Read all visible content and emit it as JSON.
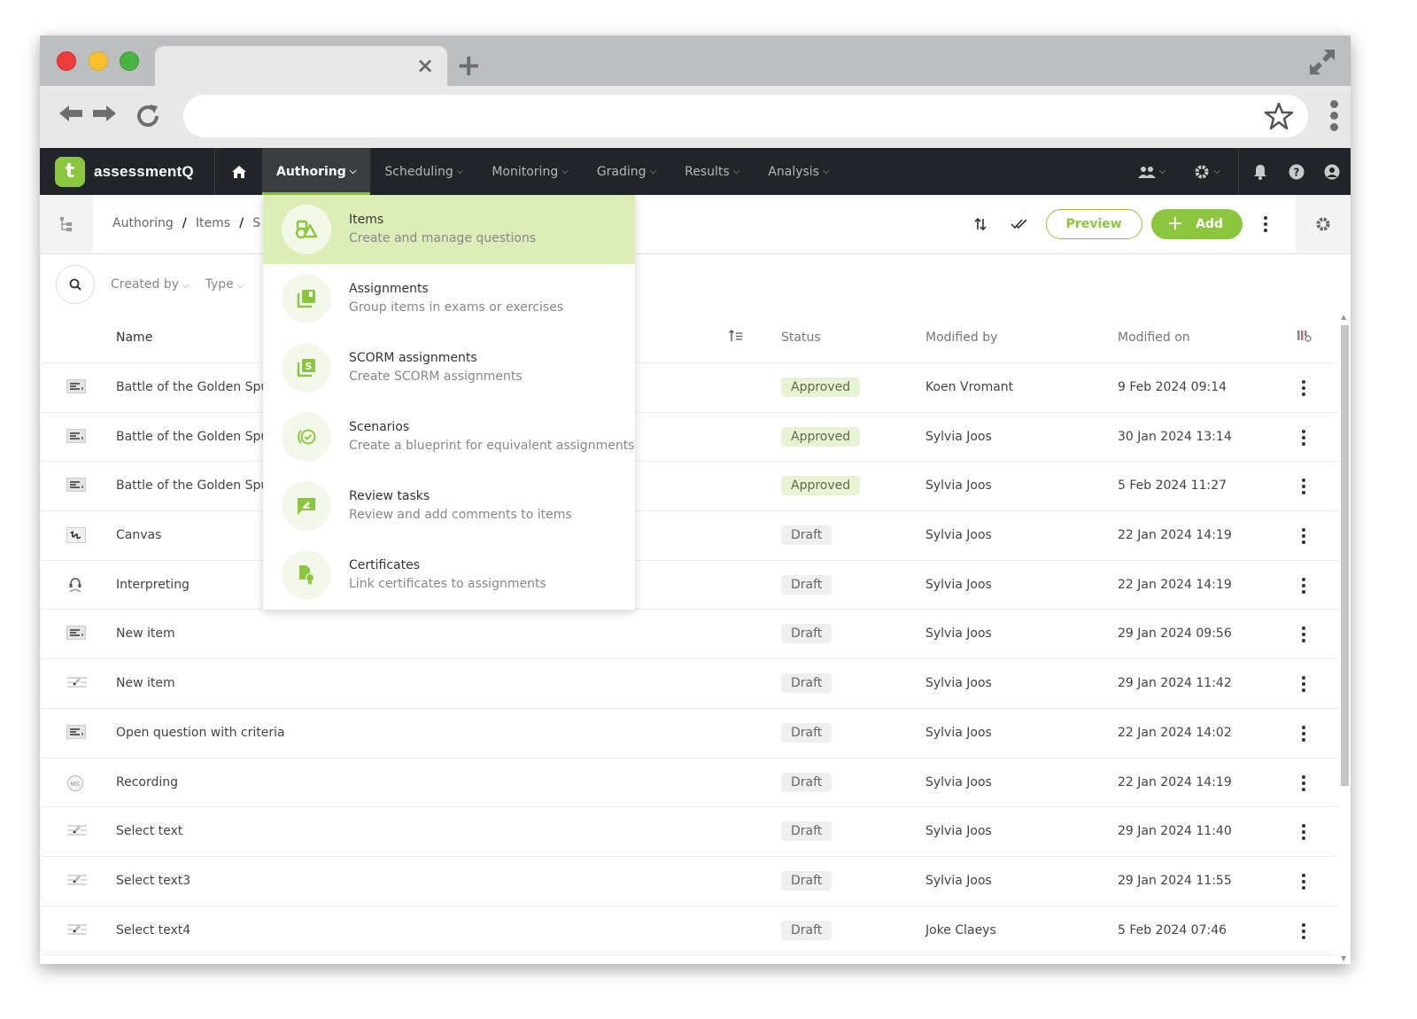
{
  "browser": {
    "tab_close_glyph": "×",
    "new_tab_glyph": "+",
    "url": ""
  },
  "app": {
    "brand_letter": "t",
    "brand_name": "assessmentQ",
    "nav": [
      {
        "label": "Authoring",
        "active": true
      },
      {
        "label": "Scheduling"
      },
      {
        "label": "Monitoring"
      },
      {
        "label": "Grading"
      },
      {
        "label": "Results"
      },
      {
        "label": "Analysis"
      }
    ],
    "chevron": "⌵",
    "accent": "#8cc63f"
  },
  "subheader": {
    "breadcrumb": [
      "Authoring",
      "Items",
      "S"
    ],
    "breadcrumb_sep": "/",
    "preview_label": "Preview",
    "add_label": "Add",
    "add_plus": "+"
  },
  "filters": {
    "created_by": "Created by",
    "type": "Type"
  },
  "table": {
    "headers": {
      "name": "Name",
      "status": "Status",
      "modified_by": "Modified by",
      "modified_on": "Modified on"
    },
    "rows": [
      {
        "icon": "open-question",
        "name": "Battle of the Golden Spur",
        "status": "Approved",
        "modified_by": "Koen Vromant",
        "modified_on": "9 Feb 2024 09:14"
      },
      {
        "icon": "open-question",
        "name": "Battle of the Golden Spur",
        "status": "Approved",
        "modified_by": "Sylvia Joos",
        "modified_on": "30 Jan 2024 13:14"
      },
      {
        "icon": "open-question",
        "name": "Battle of the Golden Spur",
        "status": "Approved",
        "modified_by": "Sylvia Joos",
        "modified_on": "5 Feb 2024 11:27"
      },
      {
        "icon": "canvas",
        "name": "Canvas",
        "status": "Draft",
        "modified_by": "Sylvia Joos",
        "modified_on": "22 Jan 2024 14:19"
      },
      {
        "icon": "interpreting",
        "name": "Interpreting",
        "status": "Draft",
        "modified_by": "Sylvia Joos",
        "modified_on": "22 Jan 2024 14:19"
      },
      {
        "icon": "open-question",
        "name": "New item",
        "status": "Draft",
        "modified_by": "Sylvia Joos",
        "modified_on": "29 Jan 2024 09:56"
      },
      {
        "icon": "select-text",
        "name": "New item",
        "status": "Draft",
        "modified_by": "Sylvia Joos",
        "modified_on": "29 Jan 2024 11:42"
      },
      {
        "icon": "open-question",
        "name": "Open question with criteria",
        "status": "Draft",
        "modified_by": "Sylvia Joos",
        "modified_on": "22 Jan 2024 14:02"
      },
      {
        "icon": "recording",
        "name": "Recording",
        "status": "Draft",
        "modified_by": "Sylvia Joos",
        "modified_on": "22 Jan 2024 14:19"
      },
      {
        "icon": "select-text",
        "name": "Select text",
        "status": "Draft",
        "modified_by": "Sylvia Joos",
        "modified_on": "29 Jan 2024 11:40"
      },
      {
        "icon": "select-text",
        "name": "Select text3",
        "status": "Draft",
        "modified_by": "Sylvia Joos",
        "modified_on": "29 Jan 2024 11:55"
      },
      {
        "icon": "select-text",
        "name": "Select text4",
        "status": "Draft",
        "modified_by": "Joke Claeys",
        "modified_on": "5 Feb 2024 07:46"
      }
    ]
  },
  "dropdown": {
    "items": [
      {
        "icon": "items",
        "title": "Items",
        "desc": "Create and manage questions",
        "active": true
      },
      {
        "icon": "assignments",
        "title": "Assignments",
        "desc": "Group items in exams or exercises"
      },
      {
        "icon": "scorm",
        "title": "SCORM assignments",
        "desc": "Create SCORM assignments"
      },
      {
        "icon": "scenarios",
        "title": "Scenarios",
        "desc": "Create a blueprint for equivalent assignments"
      },
      {
        "icon": "review",
        "title": "Review tasks",
        "desc": "Review and add comments to items"
      },
      {
        "icon": "certificates",
        "title": "Certificates",
        "desc": "Link certificates to assignments"
      }
    ]
  }
}
